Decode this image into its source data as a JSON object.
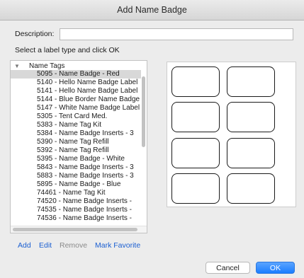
{
  "window": {
    "title": "Add Name Badge"
  },
  "description": {
    "label": "Description:",
    "value": "",
    "placeholder": ""
  },
  "instruction": "Select a label type and click OK",
  "tree": {
    "parent_label": "Name Tags",
    "items": [
      "5095 - Name Badge - Red",
      "5140 - Hello Name Badge Label",
      "5141 - Hello Name Badge Label",
      "5144 - Blue Border Name Badge",
      "5147 - White Name Badge Label",
      "5305 - Tent Card Med.",
      "5383 - Name Tag Kit",
      "5384 - Name Badge Inserts - 3",
      "5390 - Name Tag Refill",
      "5392 - Name Tag Refill",
      "5395 - Name Badge - White",
      "5843 - Name Badge Inserts - 3",
      "5883 - Name Badge Inserts - 3",
      "5895 - Name Badge - Blue",
      "74461 - Name Tag Kit",
      "74520 - Name Badge Inserts -",
      "74535 - Name Badge Inserts -",
      "74536 - Name Badge Inserts -"
    ],
    "selected_index": 0
  },
  "actions": {
    "add": "Add",
    "edit": "Edit",
    "remove": "Remove",
    "mark_favorite": "Mark Favorite"
  },
  "buttons": {
    "cancel": "Cancel",
    "ok": "OK"
  },
  "colors": {
    "link": "#1b5fd1",
    "ok_button": "#1b7dff",
    "selected_row": "#d8d8d8"
  }
}
